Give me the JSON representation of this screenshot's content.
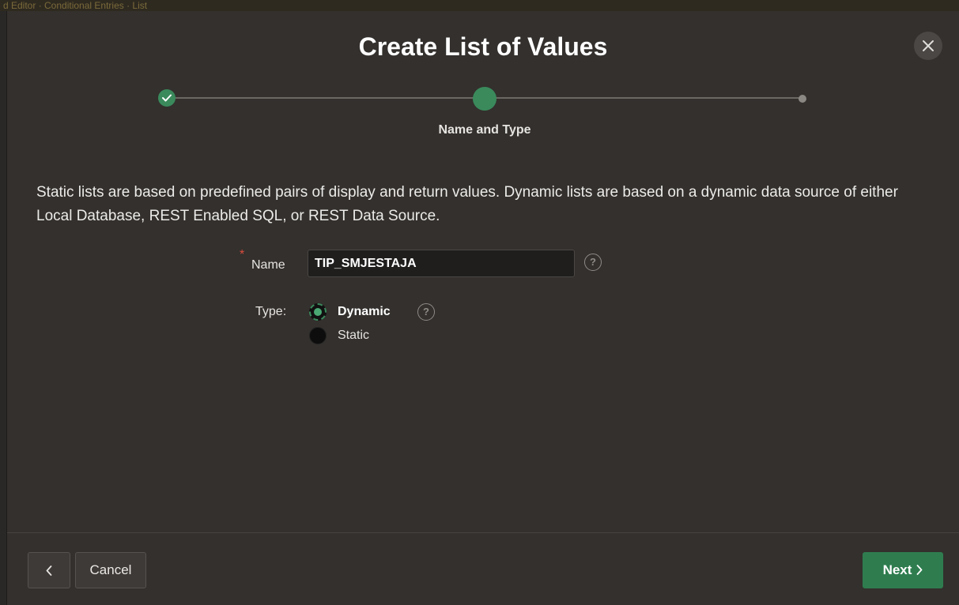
{
  "background": {
    "strip_text": "d Editor · Conditional Entries · List"
  },
  "dialog": {
    "title": "Create List of Values",
    "close_icon": "close-icon"
  },
  "wizard": {
    "steps": [
      {
        "state": "done"
      },
      {
        "state": "current",
        "label": "Name and Type"
      },
      {
        "state": "upcoming"
      }
    ],
    "current_label": "Name and Type"
  },
  "description": "Static lists are based on predefined pairs of display and return values. Dynamic lists are based on a dynamic data source of either Local Database, REST Enabled SQL, or REST Data Source.",
  "form": {
    "name": {
      "required_marker": "*",
      "label": "Name",
      "value": "TIP_SMJESTAJA",
      "help": "?"
    },
    "type": {
      "label": "Type:",
      "help": "?",
      "options": [
        {
          "label": "Dynamic",
          "checked": true
        },
        {
          "label": "Static",
          "checked": false
        }
      ]
    }
  },
  "footer": {
    "back_icon": "chevron-left-icon",
    "cancel_label": "Cancel",
    "next_label": "Next",
    "next_icon": "chevron-right-icon"
  },
  "colors": {
    "accent": "#3a8a5c",
    "dialog_bg": "#33302d",
    "required": "#d94c3d"
  }
}
